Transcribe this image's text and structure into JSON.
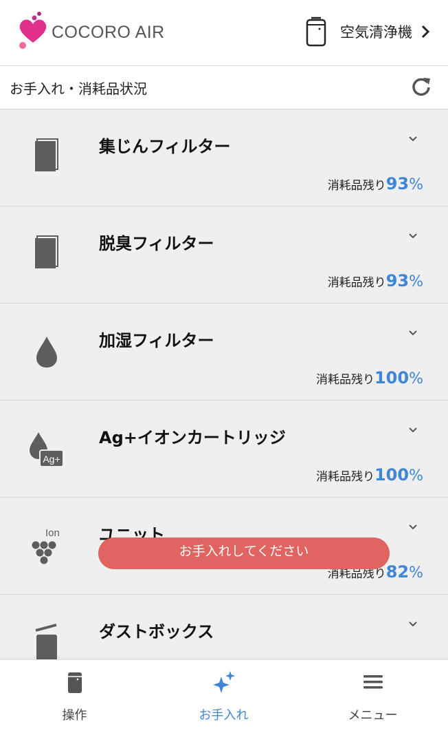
{
  "header": {
    "app_name": "COCORO AIR",
    "device_label": "空気清浄機"
  },
  "subheader": {
    "title": "お手入れ・消耗品状況"
  },
  "items": [
    {
      "title": "集じんフィルター",
      "remaining_label": "消耗品残り",
      "remaining_value": "93",
      "unit": "%",
      "icon": "filter-icon"
    },
    {
      "title": "脱臭フィルター",
      "remaining_label": "消耗品残り",
      "remaining_value": "93",
      "unit": "%",
      "icon": "filter-icon"
    },
    {
      "title": "加湿フィルター",
      "remaining_label": "消耗品残り",
      "remaining_value": "100",
      "unit": "%",
      "icon": "water-drop-icon"
    },
    {
      "title": "Ag+イオンカートリッジ",
      "remaining_label": "消耗品残り",
      "remaining_value": "100",
      "unit": "%",
      "icon": "ag-ion-icon",
      "icon_badge": "Ag+"
    },
    {
      "title": "ユニット",
      "remaining_label": "消耗品残り",
      "remaining_value": "82",
      "unit": "%",
      "icon": "ion-unit-icon",
      "icon_text": "Ion"
    },
    {
      "title": "ダストボックス",
      "icon": "dust-box-icon",
      "alert": "お手入れしてください"
    }
  ],
  "nav": {
    "operate": "操作",
    "care": "お手入れ",
    "menu": "メニュー"
  },
  "colors": {
    "accent": "#3f86d6",
    "alert": "#e0645f",
    "brand": "#e0308a"
  }
}
